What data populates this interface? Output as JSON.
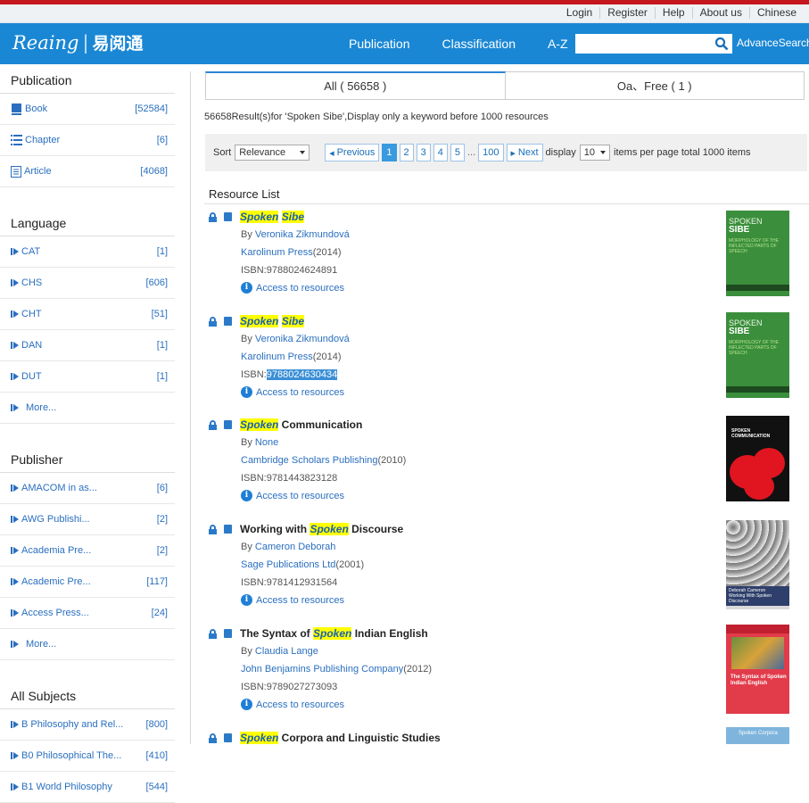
{
  "toplinks": [
    "Login",
    "Register",
    "Help",
    "About us",
    "Chinese"
  ],
  "brand": {
    "logo": "Reaing",
    "logo_cn": "易阅通"
  },
  "nav": [
    "Publication",
    "Classification",
    "A-Z"
  ],
  "search": {
    "value": "",
    "placeholder": "",
    "advance": "AdvanceSearch"
  },
  "sidebar": {
    "publication": {
      "title": "Publication",
      "items": [
        {
          "label": "Book",
          "count": "[52584]"
        },
        {
          "label": "Chapter",
          "count": "[6]"
        },
        {
          "label": "Article",
          "count": "[4068]"
        }
      ]
    },
    "language": {
      "title": "Language",
      "items": [
        {
          "label": "CAT",
          "count": "[1]"
        },
        {
          "label": "CHS",
          "count": "[606]"
        },
        {
          "label": "CHT",
          "count": "[51]"
        },
        {
          "label": "DAN",
          "count": "[1]"
        },
        {
          "label": "DUT",
          "count": "[1]"
        }
      ],
      "more": "More..."
    },
    "publisher": {
      "title": "Publisher",
      "items": [
        {
          "label": "AMACOM in as...",
          "count": "[6]"
        },
        {
          "label": "AWG Publishi...",
          "count": "[2]"
        },
        {
          "label": "Academia Pre...",
          "count": "[2]"
        },
        {
          "label": "Academic Pre...",
          "count": "[117]"
        },
        {
          "label": "Access Press...",
          "count": "[24]"
        }
      ],
      "more": "More..."
    },
    "subjects": {
      "title": "All Subjects",
      "items": [
        {
          "label": "B Philosophy and Rel...",
          "count": "[800]"
        },
        {
          "label": "B0 Philosophical The...",
          "count": "[410]"
        },
        {
          "label": "B1 World Philosophy",
          "count": "[544]"
        }
      ]
    }
  },
  "tabs": [
    "All ( 56658 )",
    "Oa、Free ( 1 )"
  ],
  "result_info": "56658Result(s)for 'Spoken Sibe',Display only a keyword before 1000 resources",
  "pager": {
    "sort_label": "Sort",
    "sort_value": "Relevance",
    "prev": "Previous",
    "pages": [
      "1",
      "2",
      "3",
      "4",
      "5"
    ],
    "current_page": "1",
    "ellipsis": "...",
    "last_page": "100",
    "next": "Next",
    "display_label": "display",
    "per_page": "10",
    "per_page_text": "items per page total 1000 items"
  },
  "resource_list_title": "Resource List",
  "results": [
    {
      "pre": "",
      "hl": "Spoken",
      "mid": " ",
      "hl2": "Sibe",
      "post": "",
      "by": "By",
      "author": "Veronika Zikmundová",
      "publisher": "Karolinum Press",
      "year": "(2014)",
      "isbn_label": "ISBN:",
      "isbn": "9788024624891",
      "access": "Access to resources",
      "cover": "green",
      "cover_title": "SPOKEN",
      "cover_title2": "SIBE",
      "cover_sub": "MORPHOLOGY OF THE INFLECTED PARTS OF SPEECH"
    },
    {
      "pre": "",
      "hl": "Spoken",
      "mid": " ",
      "hl2": "Sibe",
      "post": "",
      "by": "By",
      "author": "Veronika Zikmundová",
      "publisher": "Karolinum Press",
      "year": "(2014)",
      "isbn_label": "ISBN:",
      "isbn": "9788024630434",
      "access": "Access to resources",
      "cover": "green",
      "cover_title": "SPOKEN",
      "cover_title2": "SIBE",
      "cover_sub": "MORPHOLOGY OF THE INFLECTED PARTS OF SPEECH"
    },
    {
      "pre": "",
      "hl": "Spoken",
      "mid": " Communication",
      "hl2": "",
      "post": "",
      "by": "By",
      "author": "None",
      "publisher": "Cambridge Scholars Publishing",
      "year": "(2010)",
      "isbn_label": "ISBN:",
      "isbn": "9781443823128",
      "access": "Access to resources",
      "cover": "red",
      "cover_title": "SPOKEN COMMUNICATION"
    },
    {
      "pre": "Working with ",
      "hl": "Spoken",
      "mid": " Discourse",
      "hl2": "",
      "post": "",
      "by": "By",
      "author": "Cameron  Deborah",
      "publisher": "Sage Publications Ltd",
      "year": "(2001)",
      "isbn_label": "ISBN:",
      "isbn": "9781412931564",
      "access": "Access to resources",
      "cover": "photo",
      "cover_title": "Deborah Cameron",
      "cover_sub": "Working With Spoken Discourse"
    },
    {
      "pre": "The Syntax of ",
      "hl": "Spoken",
      "mid": " Indian English",
      "hl2": "",
      "post": "",
      "by": "By",
      "author": "Claudia Lange",
      "publisher": "John Benjamins Publishing Company",
      "year": "(2012)",
      "isbn_label": "ISBN:",
      "isbn": "9789027273093",
      "access": "Access to resources",
      "cover": "pink",
      "cover_title": "The Syntax of Spoken Indian English"
    },
    {
      "pre": "",
      "hl": "Spoken",
      "mid": " Corpora and Linguistic Studies",
      "hl2": "",
      "post": "",
      "cover": "blue",
      "cover_title": "Spoken Corpora"
    }
  ]
}
